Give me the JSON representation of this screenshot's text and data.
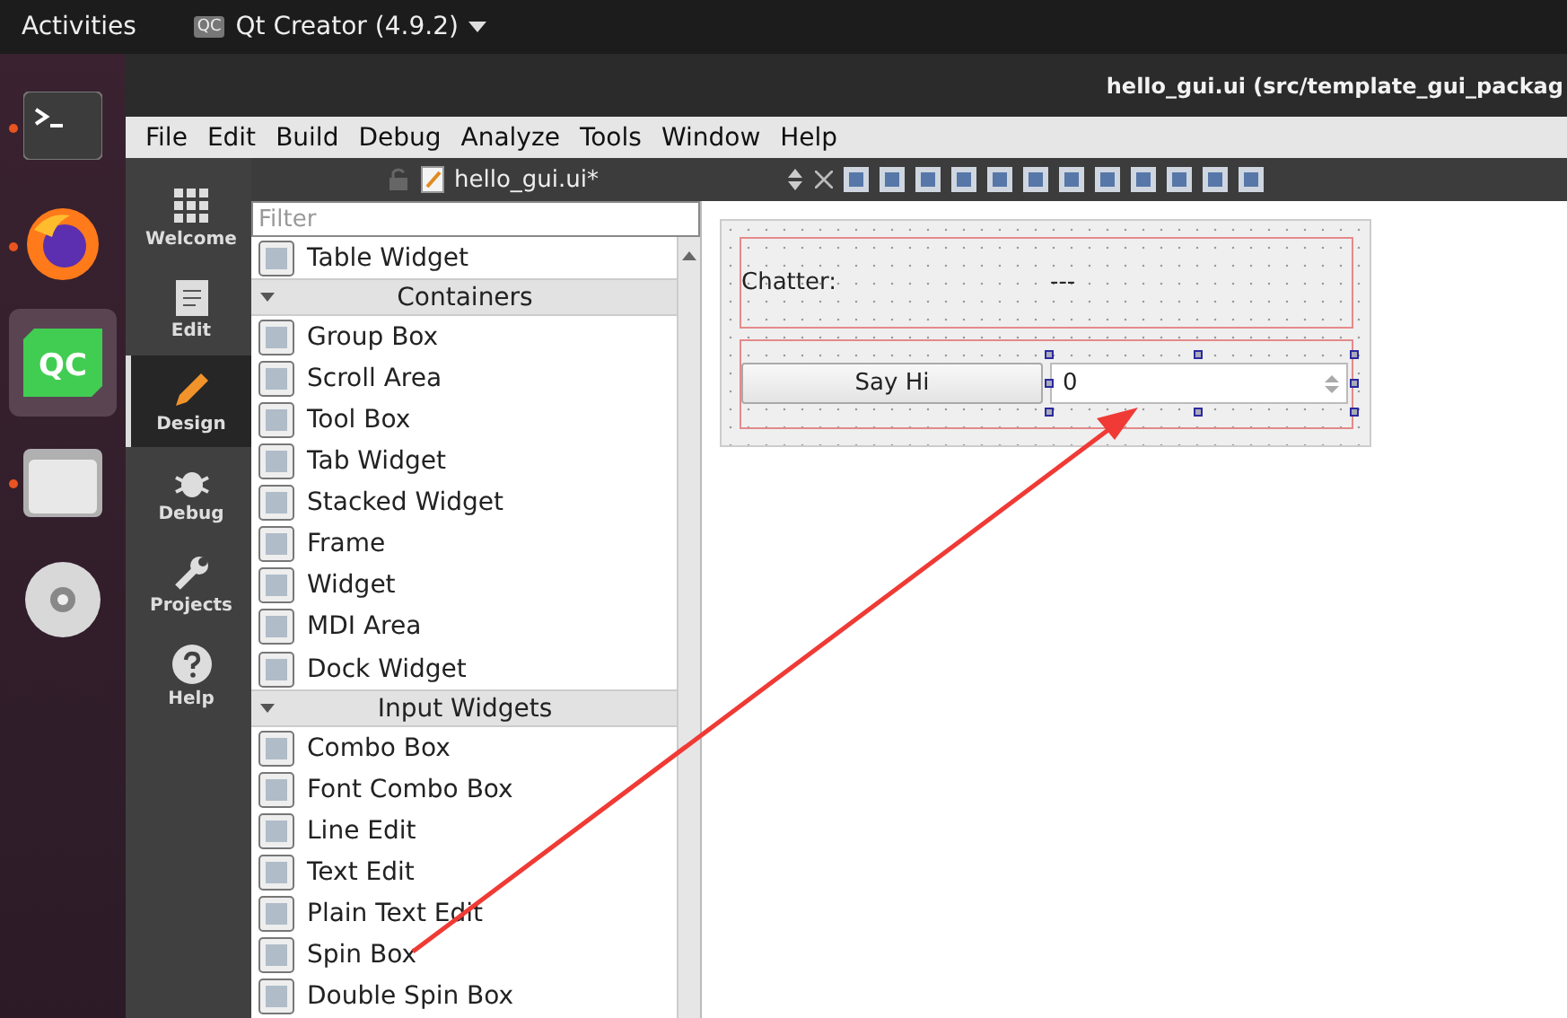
{
  "top_bar": {
    "activities": "Activities",
    "app_icon": "QC",
    "app_menu": "Qt Creator (4.9.2)"
  },
  "dock": [
    {
      "kind": "terminal",
      "running": true,
      "selected": false
    },
    {
      "kind": "browser",
      "running": true,
      "selected": false
    },
    {
      "kind": "qtcreator",
      "icon_text": "QC",
      "running": false,
      "selected": true
    },
    {
      "kind": "files",
      "running": true,
      "selected": false
    },
    {
      "kind": "disc",
      "running": false,
      "selected": false
    }
  ],
  "window": {
    "title": "hello_gui.ui (src/template_gui_packag"
  },
  "menu": [
    "File",
    "Edit",
    "Build",
    "Debug",
    "Analyze",
    "Tools",
    "Window",
    "Help"
  ],
  "editor_tab": {
    "label": "hello_gui.ui*"
  },
  "modes": [
    {
      "label": "Welcome",
      "kind": "grid",
      "selected": false
    },
    {
      "label": "Edit",
      "kind": "doc",
      "selected": false
    },
    {
      "label": "Design",
      "kind": "pencil",
      "selected": true
    },
    {
      "label": "Debug",
      "kind": "bug",
      "selected": false
    },
    {
      "label": "Projects",
      "kind": "wrench",
      "selected": false
    },
    {
      "label": "Help",
      "kind": "help",
      "selected": false
    }
  ],
  "widget_box": {
    "filter": {
      "placeholder": "Filter"
    },
    "items": [
      {
        "kind": "widget",
        "label": "Table Widget"
      },
      {
        "kind": "category",
        "label": "Containers"
      },
      {
        "kind": "widget",
        "label": "Group Box"
      },
      {
        "kind": "widget",
        "label": "Scroll Area"
      },
      {
        "kind": "widget",
        "label": "Tool Box"
      },
      {
        "kind": "widget",
        "label": "Tab Widget"
      },
      {
        "kind": "widget",
        "label": "Stacked Widget"
      },
      {
        "kind": "widget",
        "label": "Frame"
      },
      {
        "kind": "widget",
        "label": "Widget"
      },
      {
        "kind": "widget",
        "label": "MDI Area"
      },
      {
        "kind": "widget",
        "label": "Dock Widget"
      },
      {
        "kind": "category",
        "label": "Input Widgets"
      },
      {
        "kind": "widget",
        "label": "Combo Box"
      },
      {
        "kind": "widget",
        "label": "Font Combo Box"
      },
      {
        "kind": "widget",
        "label": "Line Edit"
      },
      {
        "kind": "widget",
        "label": "Text Edit"
      },
      {
        "kind": "widget",
        "label": "Plain Text Edit"
      },
      {
        "kind": "widget",
        "label": "Spin Box"
      },
      {
        "kind": "widget",
        "label": "Double Spin Box"
      }
    ]
  },
  "form": {
    "chatter_label": "Chatter:",
    "chatter_value": "---",
    "button": "Say Hi",
    "spin_value": "0"
  }
}
